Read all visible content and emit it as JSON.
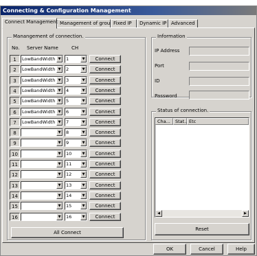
{
  "window": {
    "title": "Connecting & Configuration Management"
  },
  "tabs": [
    {
      "label": "Connect Management"
    },
    {
      "label": "Management of group."
    },
    {
      "label": "Fixed IP"
    },
    {
      "label": "Dynamic IP"
    },
    {
      "label": "Advanced"
    }
  ],
  "management": {
    "legend": "Manangement of connection.",
    "col_no": "No.",
    "col_server": "Server Name",
    "col_ch": "CH",
    "rows": [
      {
        "no": "1",
        "server": "LowBandWidth",
        "ch": "1",
        "button": "Connect"
      },
      {
        "no": "2",
        "server": "LowBandWidth",
        "ch": "2",
        "button": "Connect"
      },
      {
        "no": "3",
        "server": "LowBandWidth",
        "ch": "3",
        "button": "Connect"
      },
      {
        "no": "4",
        "server": "LowBandWidth",
        "ch": "4",
        "button": "Connect"
      },
      {
        "no": "5",
        "server": "LowBandWidth",
        "ch": "5",
        "button": "Connect"
      },
      {
        "no": "6",
        "server": "LowBandWidth",
        "ch": "6",
        "button": "Connect"
      },
      {
        "no": "7",
        "server": "LowBandWidth",
        "ch": "7",
        "button": "Connect"
      },
      {
        "no": "8",
        "server": "",
        "ch": "8",
        "button": "Connect"
      },
      {
        "no": "9",
        "server": "",
        "ch": "9",
        "button": "Connect"
      },
      {
        "no": "10",
        "server": "",
        "ch": "10",
        "button": "Connect"
      },
      {
        "no": "11",
        "server": "",
        "ch": "11",
        "button": "Connect"
      },
      {
        "no": "12",
        "server": "",
        "ch": "12",
        "button": "Connect"
      },
      {
        "no": "13",
        "server": "",
        "ch": "13",
        "button": "Connect"
      },
      {
        "no": "14",
        "server": "",
        "ch": "14",
        "button": "Connect"
      },
      {
        "no": "15",
        "server": "",
        "ch": "15",
        "button": "Connect"
      },
      {
        "no": "16",
        "server": "",
        "ch": "16",
        "button": "Connect"
      }
    ],
    "all_connect": "All Connect"
  },
  "information": {
    "legend": "Information",
    "ip_label": "IP Address",
    "port_label": "Port",
    "id_label": "ID",
    "password_label": "Password"
  },
  "status": {
    "legend": "Status of connection.",
    "columns": [
      "Cha...",
      "Stat...",
      "Etc"
    ],
    "reset": "Reset"
  },
  "footer": {
    "ok": "OK",
    "cancel": "Cancel",
    "help": "Help"
  },
  "icons": {
    "dropdown": "chevron-down-icon",
    "scroll_left": "scroll-left-icon",
    "scroll_right": "scroll-right-icon"
  }
}
